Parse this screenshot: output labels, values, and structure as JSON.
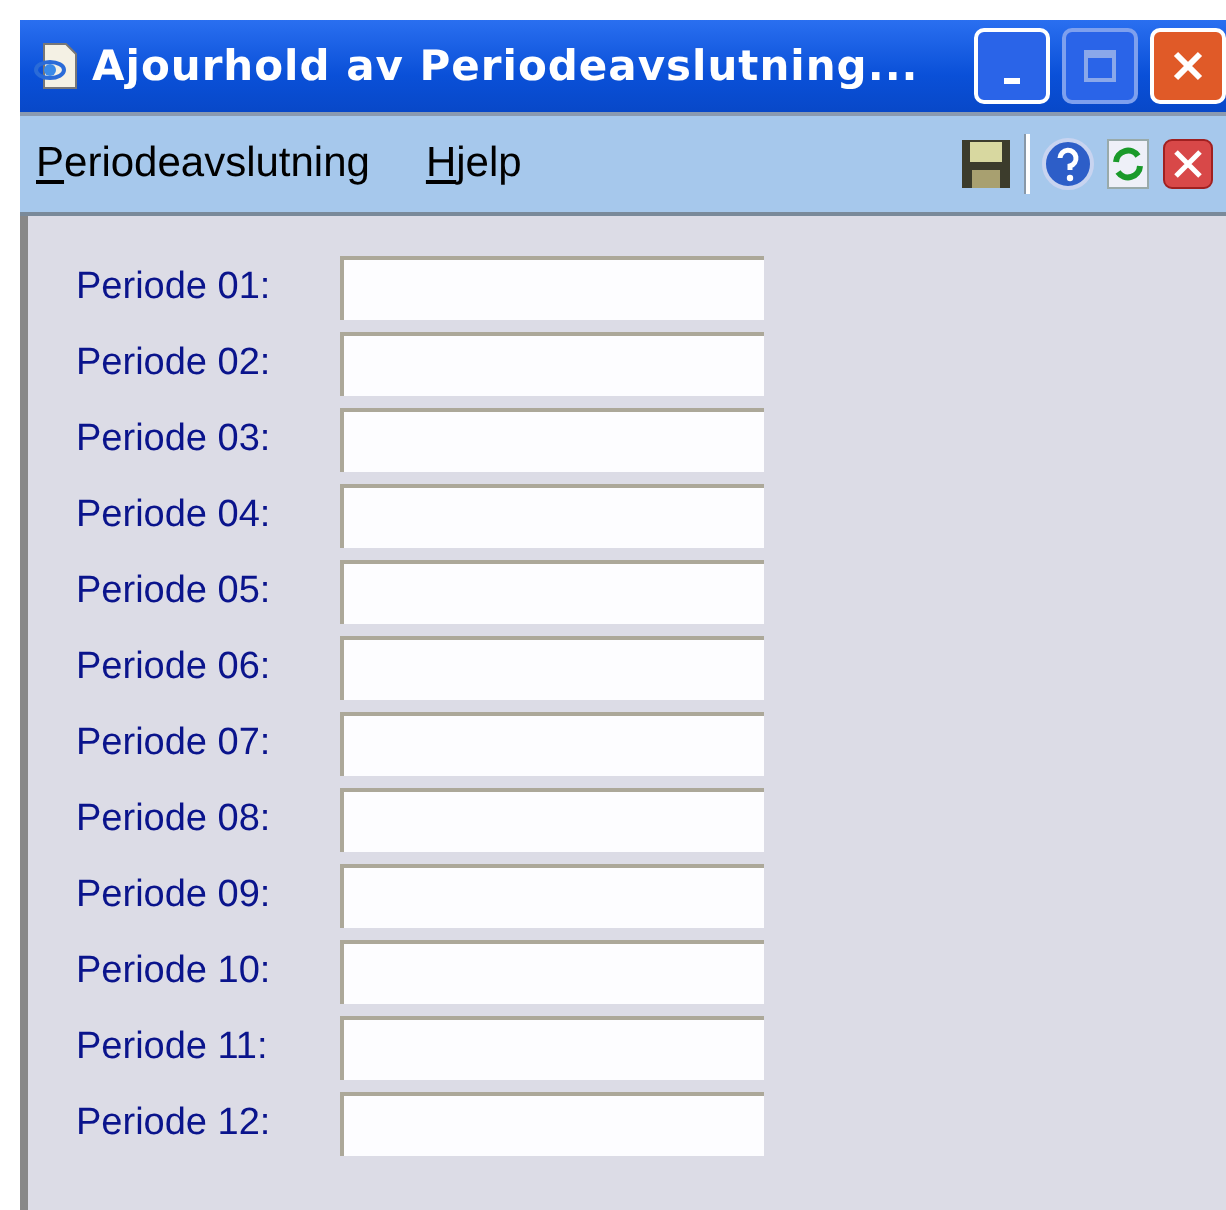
{
  "window": {
    "title": "Ajourhold av Periodeavslutning..."
  },
  "menu": [
    {
      "label": "Periodeavslutning"
    },
    {
      "label": "Hjelp"
    }
  ],
  "fields": [
    {
      "label": "Periode 01:"
    },
    {
      "label": "Periode 02:"
    },
    {
      "label": "Periode 03:"
    },
    {
      "label": "Periode 04:"
    },
    {
      "label": "Periode 05:"
    },
    {
      "label": "Periode 06:"
    },
    {
      "label": "Periode 07:"
    },
    {
      "label": "Periode 08:"
    },
    {
      "label": "Periode 09:"
    },
    {
      "label": "Periode 10:"
    },
    {
      "label": "Periode 11:"
    },
    {
      "label": "Periode 12:"
    }
  ]
}
